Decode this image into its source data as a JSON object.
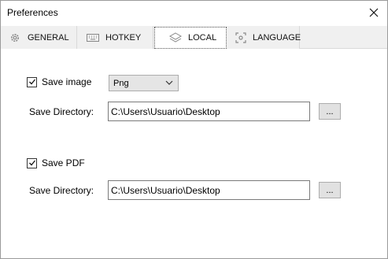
{
  "window": {
    "title": "Preferences"
  },
  "tabs": [
    {
      "label": "GENERAL",
      "icon": "gear-icon",
      "active": false
    },
    {
      "label": "HOTKEY",
      "icon": "keyboard-icon",
      "active": false
    },
    {
      "label": "LOCAL",
      "icon": "layers-icon",
      "active": true
    },
    {
      "label": "LANGUAGE",
      "icon": "focus-frame-icon",
      "active": false
    }
  ],
  "image_section": {
    "checkbox_label": "Save image",
    "checked": true,
    "format_value": "Png",
    "dir_label": "Save Directory:",
    "dir_value": "C:\\Users\\Usuario\\Desktop",
    "browse_label": "..."
  },
  "pdf_section": {
    "checkbox_label": "Save PDF",
    "checked": true,
    "dir_label": "Save Directory:",
    "dir_value": "C:\\Users\\Usuario\\Desktop",
    "browse_label": "..."
  },
  "colors": {
    "tab_bg": "#f0f0f0",
    "border": "#9a9a9a"
  }
}
